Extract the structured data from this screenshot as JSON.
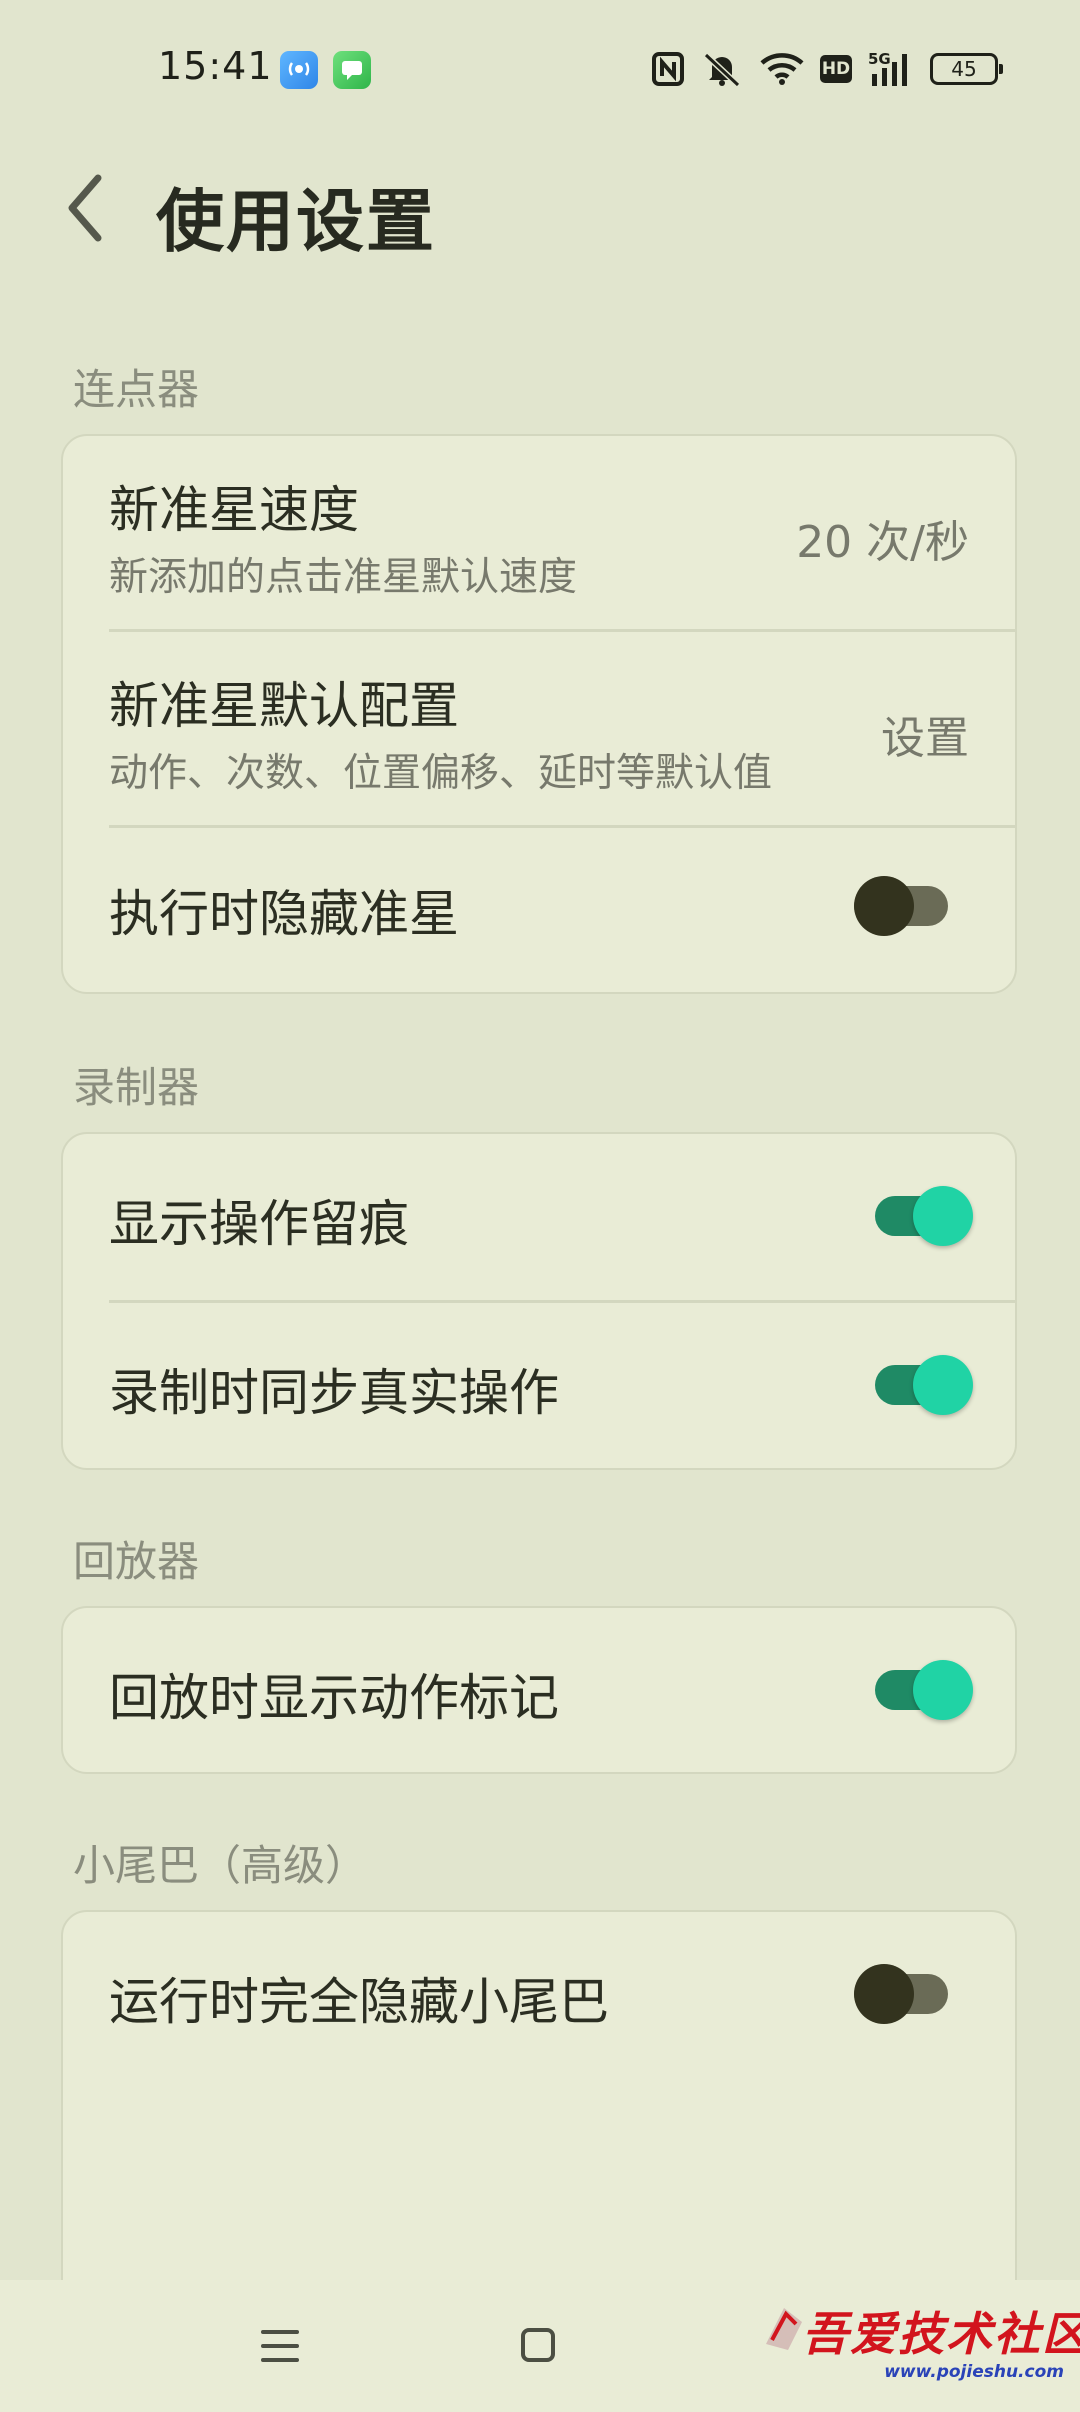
{
  "status_bar": {
    "time": "15:41",
    "battery": "45",
    "network": "5G"
  },
  "header": {
    "title": "使用设置"
  },
  "sections": {
    "clicker": {
      "title": "连点器",
      "new_crosshair_speed": {
        "title": "新准星速度",
        "subtitle": "新添加的点击准星默认速度",
        "value": "20 次/秒"
      },
      "new_crosshair_default": {
        "title": "新准星默认配置",
        "subtitle": "动作、次数、位置偏移、延时等默认值",
        "value": "设置"
      },
      "hide_crosshair": {
        "title": "执行时隐藏准星",
        "enabled": false
      }
    },
    "recorder": {
      "title": "录制器",
      "show_traces": {
        "title": "显示操作留痕",
        "enabled": true
      },
      "sync_real_ops": {
        "title": "录制时同步真实操作",
        "enabled": true
      }
    },
    "player": {
      "title": "回放器",
      "show_action_marks": {
        "title": "回放时显示动作标记",
        "enabled": true
      }
    },
    "tail": {
      "title": "小尾巴（高级）",
      "hide_tail": {
        "title": "运行时完全隐藏小尾巴",
        "enabled": false
      }
    }
  },
  "watermark": {
    "text": "吾爱技术社区",
    "url": "www.pojieshu.com"
  },
  "colors": {
    "background": "#e1e5ce",
    "card": "#e9ecd6",
    "switch_on": "#20d3a5",
    "switch_off": "#33331e"
  }
}
